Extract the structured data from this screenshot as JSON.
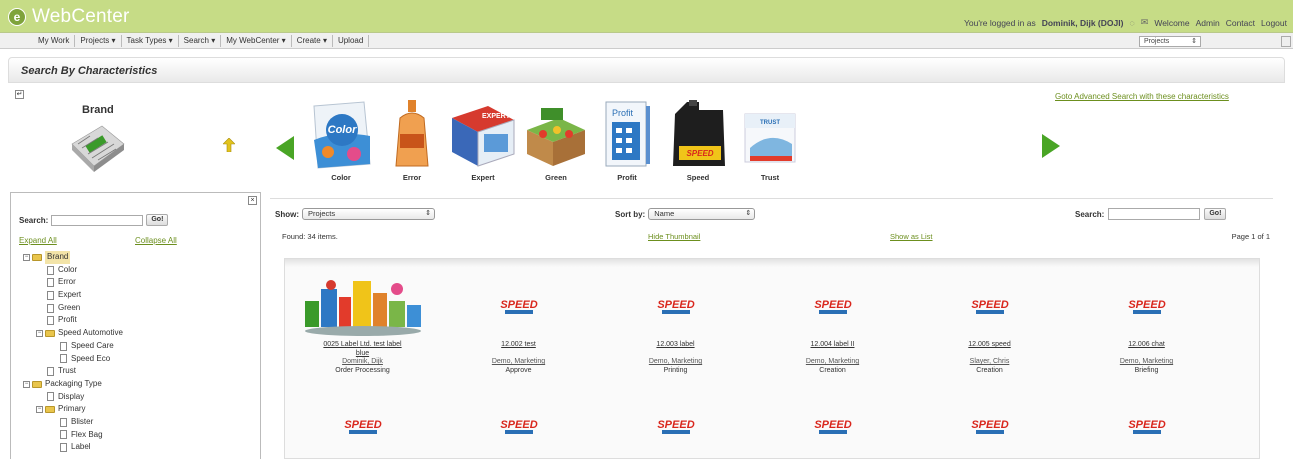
{
  "app": {
    "name": "WebCenter"
  },
  "header": {
    "login_prefix": "You're logged in as",
    "user": "Dominik, Dijk (DOJI)",
    "links": [
      "Welcome",
      "Admin",
      "Contact",
      "Logout"
    ]
  },
  "menu": {
    "items": [
      "My Work",
      "Projects ▾",
      "Task Types ▾",
      "Search ▾",
      "My WebCenter ▾",
      "Create ▾",
      "Upload"
    ],
    "scope_select": "Projects"
  },
  "page": {
    "title": "Search By Characteristics"
  },
  "characteristic": {
    "name": "Brand"
  },
  "carousel": {
    "items": [
      {
        "label": "Color",
        "icon": "color-pouch"
      },
      {
        "label": "Error",
        "icon": "error-bottle"
      },
      {
        "label": "Expert",
        "icon": "expert-box"
      },
      {
        "label": "Green",
        "icon": "green-crate"
      },
      {
        "label": "Profit",
        "icon": "profit-box"
      },
      {
        "label": "Speed",
        "icon": "speed-oil-can"
      },
      {
        "label": "Trust",
        "icon": "trust-box"
      }
    ],
    "advanced_link": "Goto Advanced Search with these characteristics"
  },
  "tree_panel": {
    "search_label": "Search:",
    "go_label": "Go!",
    "expand_all": "Expand All",
    "collapse_all": "Collapse All",
    "nodes": [
      {
        "label": "Brand",
        "type": "folder",
        "level": 0,
        "toggle": "−",
        "selected": true
      },
      {
        "label": "Color",
        "type": "doc",
        "level": 1
      },
      {
        "label": "Error",
        "type": "doc",
        "level": 1
      },
      {
        "label": "Expert",
        "type": "doc",
        "level": 1
      },
      {
        "label": "Green",
        "type": "doc",
        "level": 1
      },
      {
        "label": "Profit",
        "type": "doc",
        "level": 1
      },
      {
        "label": "Speed Automotive",
        "type": "folder",
        "level": 1,
        "toggle": "−"
      },
      {
        "label": "Speed Care",
        "type": "doc",
        "level": 2
      },
      {
        "label": "Speed Eco",
        "type": "doc",
        "level": 2
      },
      {
        "label": "Trust",
        "type": "doc",
        "level": 1
      },
      {
        "label": "Packaging Type",
        "type": "folder",
        "level": 0,
        "toggle": "−"
      },
      {
        "label": "Display",
        "type": "doc",
        "level": 1
      },
      {
        "label": "Primary",
        "type": "folder",
        "level": 1,
        "toggle": "−"
      },
      {
        "label": "Blister",
        "type": "doc",
        "level": 2
      },
      {
        "label": "Flex Bag",
        "type": "doc",
        "level": 2
      },
      {
        "label": "Label",
        "type": "doc",
        "level": 2
      }
    ]
  },
  "results": {
    "show_label": "Show:",
    "show_value": "Projects",
    "sort_label": "Sort by:",
    "sort_value": "Name",
    "search_label": "Search:",
    "go_label": "Go!",
    "found": "Found: 34 items.",
    "hide_thumbnail": "Hide Thumbnail",
    "show_as_list": "Show as List",
    "page_info": "Page 1 of 1",
    "row1": [
      {
        "name": "0025 Label Ltd. test label",
        "name2": "blue",
        "owner": "Dominik, Dijk",
        "status": "Order Processing",
        "thumb": "product-collage"
      },
      {
        "name": "12.002 test",
        "owner": "Demo, Marketing",
        "status": "Approve",
        "thumb": "speed-logo"
      },
      {
        "name": "12.003 label",
        "owner": "Demo, Marketing",
        "status": "Printing",
        "thumb": "speed-logo"
      },
      {
        "name": "12.004 label II",
        "owner": "Demo, Marketing",
        "status": "Creation",
        "thumb": "speed-logo"
      },
      {
        "name": "12.005 speed",
        "owner": "Slayer, Chris",
        "status": "Creation",
        "thumb": "speed-logo"
      },
      {
        "name": "12.006 chat",
        "owner": "Demo, Marketing",
        "status": "Briefing",
        "thumb": "speed-logo"
      }
    ],
    "row2_thumbs": [
      "speed-logo",
      "speed-logo",
      "speed-logo",
      "speed-logo",
      "speed-logo",
      "speed-logo"
    ],
    "speed_logo_text": "SPEED"
  },
  "colors": {
    "header_green": "#c6dc86",
    "link_green": "#6c8f1e",
    "arrow_green": "#49a525",
    "speed_red": "#d9261c",
    "speed_blue": "#2a6fb5"
  }
}
